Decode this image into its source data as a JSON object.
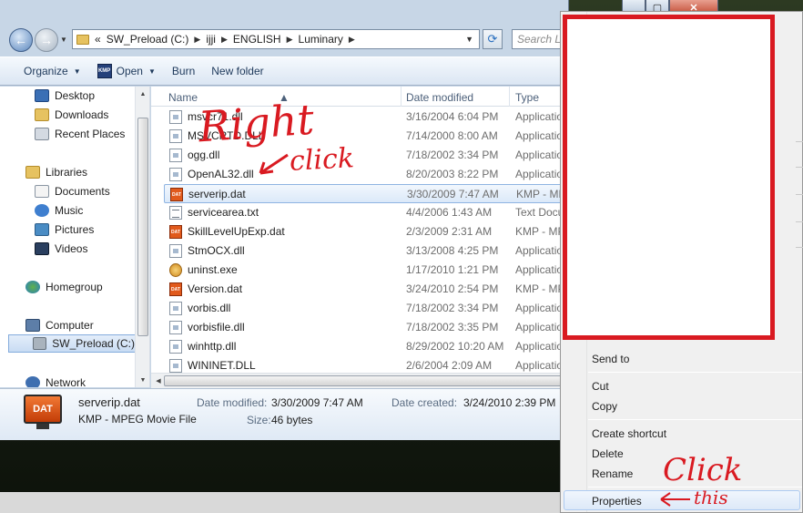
{
  "address_bar": {
    "overflow": "«",
    "crumbs": [
      "SW_Preload (C:)",
      "ijji",
      "ENGLISH",
      "Luminary"
    ]
  },
  "search": {
    "placeholder": "Search Lu"
  },
  "toolbar": {
    "organize": "Organize",
    "open": "Open",
    "burn": "Burn",
    "new_folder": "New folder"
  },
  "navpane": {
    "favorites": [
      "Desktop",
      "Downloads",
      "Recent Places"
    ],
    "libraries": "Libraries",
    "library_items": [
      "Documents",
      "Music",
      "Pictures",
      "Videos"
    ],
    "homegroup": "Homegroup",
    "computer": "Computer",
    "drive": "SW_Preload (C:)",
    "network": "Network"
  },
  "columns": {
    "name": "Name",
    "date": "Date modified",
    "type": "Type"
  },
  "files": [
    {
      "name": "msvcr71.dll",
      "date": "3/16/2004 6:04 PM",
      "type": "Application",
      "icon": "dll"
    },
    {
      "name": "MSVCRTD.DLL",
      "date": "7/14/2000 8:00 AM",
      "type": "Application",
      "icon": "dll"
    },
    {
      "name": "ogg.dll",
      "date": "7/18/2002 3:34 PM",
      "type": "Application",
      "icon": "dll"
    },
    {
      "name": "OpenAL32.dll",
      "date": "8/20/2003 8:22 PM",
      "type": "Application",
      "icon": "dll"
    },
    {
      "name": "serverip.dat",
      "date": "3/30/2009 7:47 AM",
      "type": "KMP - MP",
      "icon": "dat"
    },
    {
      "name": "servicearea.txt",
      "date": "4/4/2006 1:43 AM",
      "type": "Text Docu",
      "icon": "txt"
    },
    {
      "name": "SkillLevelUpExp.dat",
      "date": "2/3/2009 2:31 AM",
      "type": "KMP - MP",
      "icon": "dat"
    },
    {
      "name": "StmOCX.dll",
      "date": "3/13/2008 4:25 PM",
      "type": "Application",
      "icon": "dll"
    },
    {
      "name": "uninst.exe",
      "date": "1/17/2010 1:21 PM",
      "type": "Application",
      "icon": "exe"
    },
    {
      "name": "Version.dat",
      "date": "3/24/2010 2:54 PM",
      "type": "KMP - MP",
      "icon": "dat"
    },
    {
      "name": "vorbis.dll",
      "date": "7/18/2002 3:34 PM",
      "type": "Application",
      "icon": "dll"
    },
    {
      "name": "vorbisfile.dll",
      "date": "7/18/2002 3:35 PM",
      "type": "Application",
      "icon": "dll"
    },
    {
      "name": "winhttp.dll",
      "date": "8/29/2002 10:20 AM",
      "type": "Application",
      "icon": "dll"
    },
    {
      "name": "WININET.DLL",
      "date": "2/6/2004 2:09 AM",
      "type": "Application",
      "icon": "dll"
    }
  ],
  "selected_file_index": 4,
  "details": {
    "icon_text": "DAT",
    "file_name": "serverip.dat",
    "file_type": "KMP - MPEG Movie File",
    "modified_label": "Date modified:",
    "modified_value": "3/30/2009 7:47 AM",
    "created_label": "Date created:",
    "created_value": "3/24/2010 2:39 PM",
    "size_label": "Size:",
    "size_value": "46 bytes"
  },
  "file_icon_text": "DAT",
  "toolbar_open_icon_text": "KMP",
  "context_menu": {
    "send_to": "Send to",
    "cut": "Cut",
    "copy": "Copy",
    "create_shortcut": "Create shortcut",
    "delete": "Delete",
    "rename": "Rename",
    "properties": "Properties"
  },
  "annotations": {
    "right": "Right",
    "click1": "click",
    "click2": "Click",
    "this": "this"
  },
  "colors": {
    "annotation_red": "#d91a21",
    "redaction_border": "#d91a21"
  }
}
